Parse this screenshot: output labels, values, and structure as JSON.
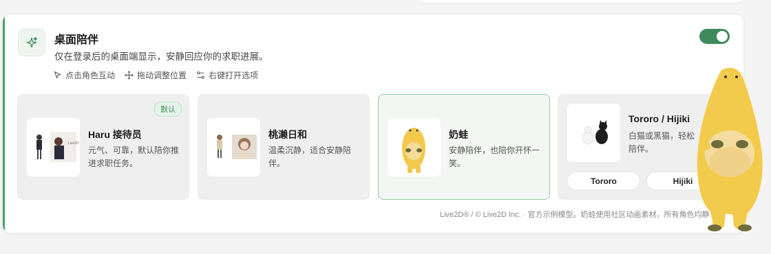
{
  "feature": {
    "title": "桌面陪伴",
    "description": "仅在登录后的桌面端显示，安静回应你的求职进展。",
    "icon": "sparkles-icon",
    "enabled": true,
    "hints": [
      {
        "icon": "cursor-icon",
        "label": "点击角色互动"
      },
      {
        "icon": "move-icon",
        "label": "拖动调整位置"
      },
      {
        "icon": "right-click-icon",
        "label": "右键打开选项"
      }
    ]
  },
  "characters": [
    {
      "name": "Haru 接待员",
      "description": "元气、可靠，默认陪你推进求职任务。",
      "badge": "默认",
      "selected": false
    },
    {
      "name": "桃濑日和",
      "description": "温柔沉静，适合安静陪伴。",
      "selected": false
    },
    {
      "name": "奶蛙",
      "description": "安静陪伴，也陪你开怀一笑。",
      "selected": true
    },
    {
      "name": "Tororo / Hijiki",
      "description": "白猫或黑猫，轻松陪伴。",
      "selected": false,
      "variants": [
        "Tororo",
        "Hijiki"
      ]
    }
  ],
  "footer": "Live2D® / © Live2D Inc. · 官方示例模型。奶蛙使用社区动画素材，所有角色均静",
  "colors": {
    "accent": "#43a36a",
    "toggle_on": "#3f8a5c",
    "selected_border": "#8fcfa5"
  }
}
